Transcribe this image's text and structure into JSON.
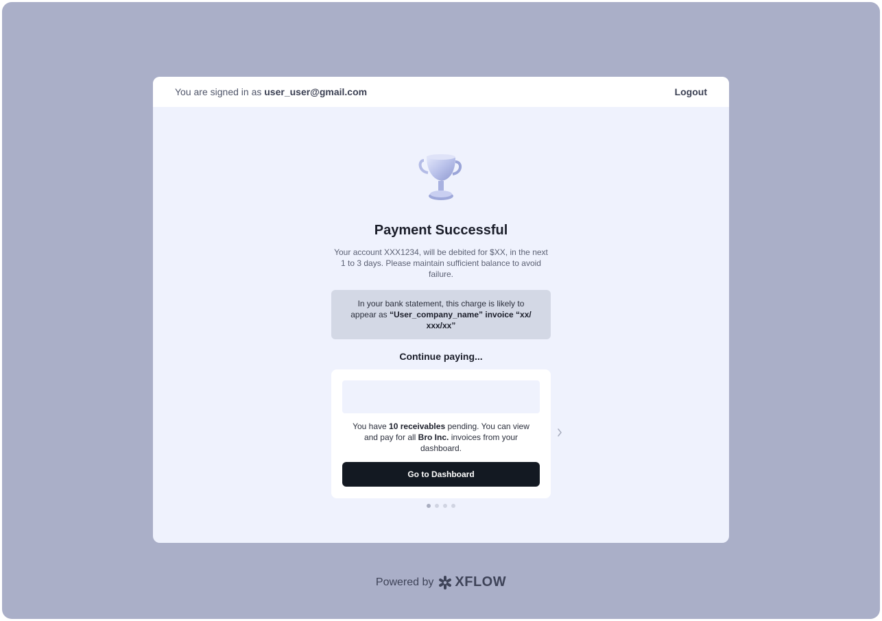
{
  "header": {
    "signed_in_prefix": "You are signed in as",
    "user_email": "user_user@gmail.com",
    "logout_label": "Logout"
  },
  "success": {
    "icon": "trophy-icon",
    "title": "Payment Successful",
    "description": "Your account XXX1234, will be debited for $XX, in the next 1 to 3 days. Please maintain sufficient balance to avoid failure."
  },
  "notice": {
    "prefix": "In your bank statement, this charge is likely to appear as",
    "charge_name": "“User_company_name” invoice “xx/ xxx/xx”"
  },
  "continue": {
    "heading": "Continue paying...",
    "card": {
      "text_before": "You have",
      "receivables": "10 receivables",
      "text_middle": "pending. You can view and pay for all",
      "company": "Bro Inc.",
      "text_after": "invoices from your dashboard.",
      "button_label": "Go to Dashboard"
    },
    "carousel": {
      "total_pages": 4,
      "active_page": 1
    }
  },
  "footer": {
    "powered_by": "Powered by",
    "brand": "XFLOW"
  },
  "colors": {
    "background": "#aaafc8",
    "card": "#eff2fd",
    "button": "#131922",
    "notice": "#d3d8e5"
  }
}
